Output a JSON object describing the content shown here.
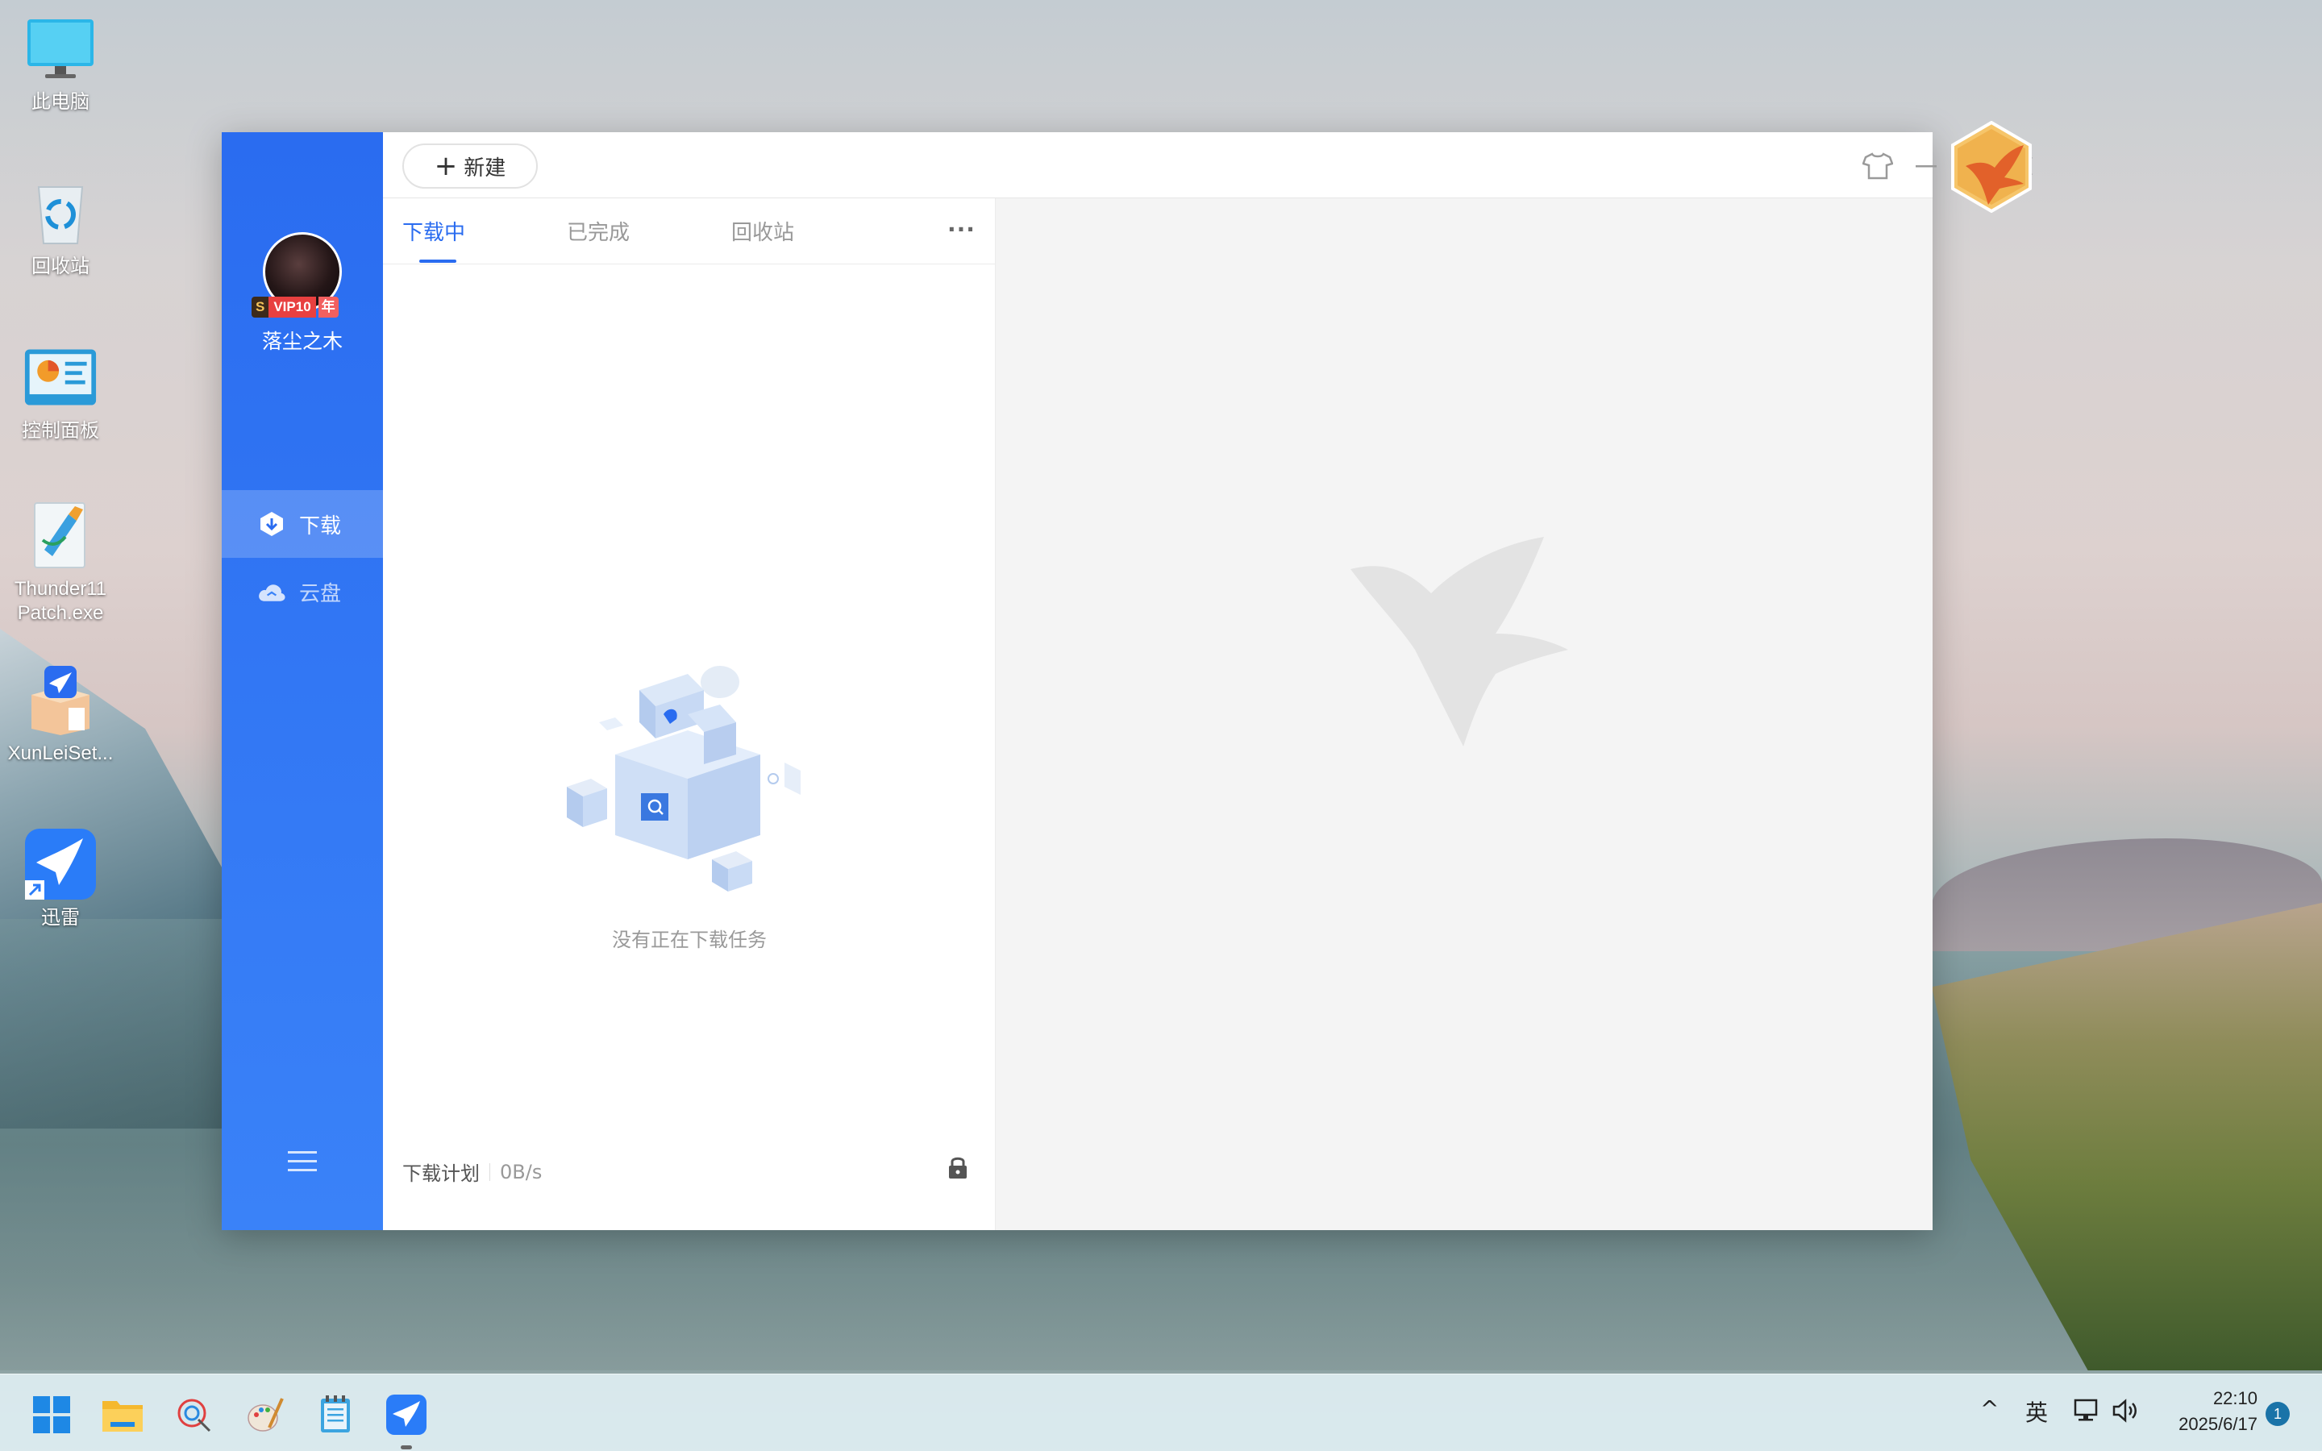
{
  "desktop": {
    "icons": [
      {
        "label": "此电脑",
        "icon": "computer-icon"
      },
      {
        "label": "回收站",
        "icon": "recycle-bin-icon"
      },
      {
        "label": "控制面板",
        "icon": "control-panel-icon"
      },
      {
        "label": "Thunder11\nPatch.exe",
        "icon": "patch-exe-icon"
      },
      {
        "label": "XunLeiSet...",
        "icon": "installer-icon"
      },
      {
        "label": "迅雷",
        "icon": "thunder-shortcut-icon"
      }
    ]
  },
  "app": {
    "new_button": "新建",
    "user": {
      "name": "落尘之木",
      "vip_s": "S",
      "vip_label": "VIP10",
      "vip_year": "年"
    },
    "nav": [
      {
        "label": "下载",
        "icon": "download-icon",
        "active": true
      },
      {
        "label": "云盘",
        "icon": "cloud-icon",
        "active": false
      }
    ],
    "tabs": [
      {
        "label": "下载中",
        "active": true
      },
      {
        "label": "已完成",
        "active": false
      },
      {
        "label": "回收站",
        "active": false
      }
    ],
    "more": "···",
    "empty_message": "没有正在下载任务",
    "footer": {
      "plan": "下载计划",
      "speed": "0B/s"
    },
    "accent_color": "#2a6cf0"
  },
  "taskbar": {
    "apps": [
      "start-icon",
      "file-explorer-icon",
      "paint-3d-icon",
      "paint-icon",
      "notepad-icon",
      "thunder-icon"
    ],
    "tray": {
      "chevron": "^",
      "ime": "英"
    },
    "clock": {
      "time": "22:10",
      "date": "2025/6/17"
    },
    "notifications": "1"
  }
}
